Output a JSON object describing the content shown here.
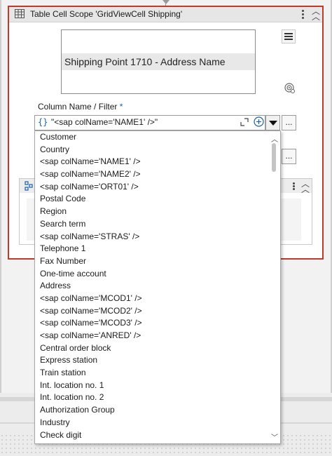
{
  "activity": {
    "title": "Table Cell Scope 'GridViewCell Shipping'",
    "border_color": "#c0392b"
  },
  "preview": {
    "selected_text": "Shipping Point 1710 - Address Name"
  },
  "column_field": {
    "label": "Column Name / Filter",
    "required_marker": "*",
    "braces": "{}",
    "value": "\"<sap colName='NAME1' />\"",
    "ellipsis": "..."
  },
  "second_field": {
    "ellipsis": "..."
  },
  "dropdown": {
    "items": [
      "Customer",
      "Country",
      "<sap colName='NAME1' />",
      "<sap colName='NAME2' />",
      "<sap colName='ORT01' />",
      "Postal Code",
      "Region",
      "Search term",
      "<sap colName='STRAS' />",
      "Telephone 1",
      "Fax Number",
      "One-time account",
      "Address",
      "<sap colName='MCOD1' />",
      "<sap colName='MCOD2' />",
      "<sap colName='MCOD3' />",
      "<sap colName='ANRED' />",
      "Central order block",
      "Express station",
      "Train station",
      "Int. location no. 1",
      "Int. location no. 2",
      "Authorization Group",
      "Industry",
      "Check digit"
    ]
  },
  "icons": {
    "table": "table-icon",
    "kebab": "more-vertical-icon",
    "collapse": "chevron-double-up-icon",
    "menu": "hamburger-icon",
    "target": "target-icon",
    "expand": "expand-icon",
    "add": "plus-circle-icon",
    "dropdown": "caret-down-icon",
    "scroll_up": "chevron-up-icon",
    "scroll_down": "chevron-down-icon"
  }
}
